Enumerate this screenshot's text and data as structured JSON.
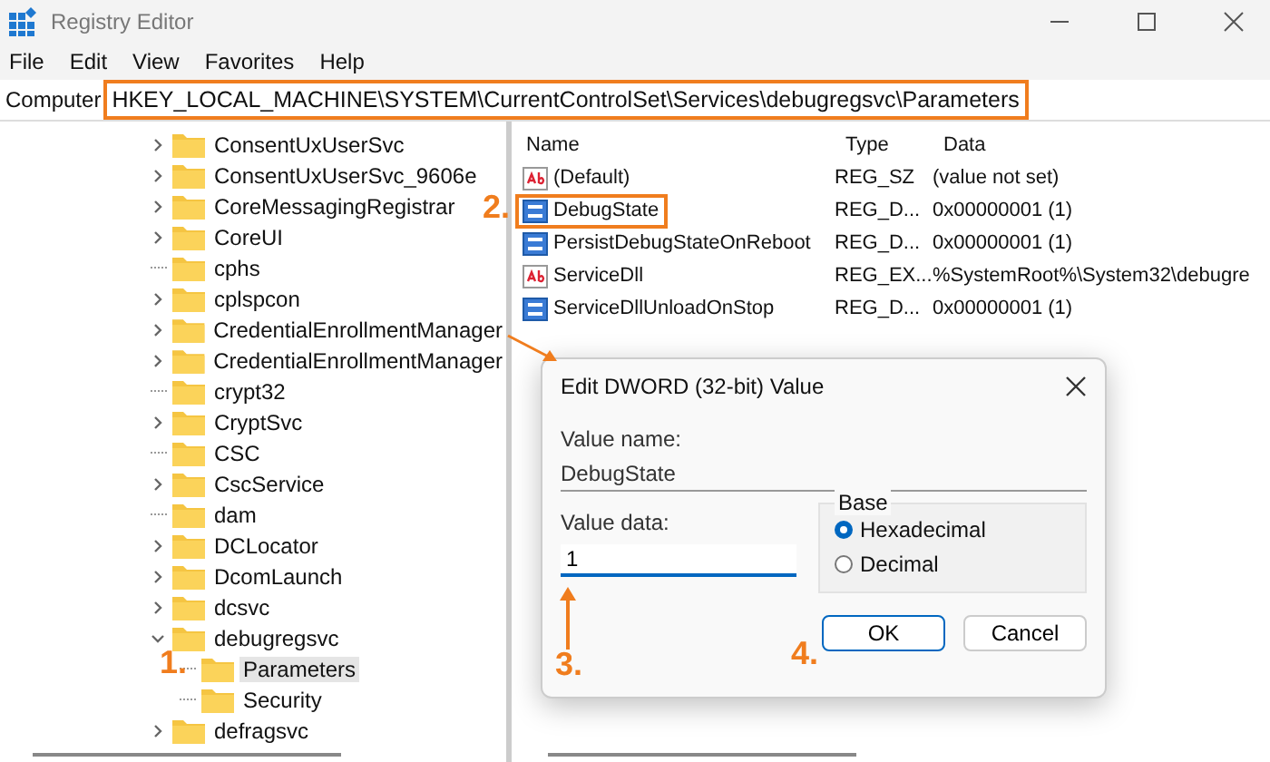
{
  "window": {
    "title": "Registry Editor"
  },
  "menu": [
    "File",
    "Edit",
    "View",
    "Favorites",
    "Help"
  ],
  "address": {
    "prefix": "Computer",
    "path": "HKEY_LOCAL_MACHINE\\SYSTEM\\CurrentControlSet\\Services\\debugregsvc\\Parameters",
    "highlighted": true
  },
  "tree": [
    {
      "label": "ConsentUxUserSvc",
      "expandable": true,
      "expanded": false,
      "selected": false
    },
    {
      "label": "ConsentUxUserSvc_9606e",
      "expandable": true,
      "expanded": false,
      "selected": false
    },
    {
      "label": "CoreMessagingRegistrar",
      "expandable": true,
      "expanded": false,
      "selected": false
    },
    {
      "label": "CoreUI",
      "expandable": true,
      "expanded": false,
      "selected": false
    },
    {
      "label": "cphs",
      "expandable": false,
      "selected": false
    },
    {
      "label": "cplspcon",
      "expandable": true,
      "expanded": false,
      "selected": false
    },
    {
      "label": "CredentialEnrollmentManager",
      "expandable": true,
      "expanded": false,
      "selected": false
    },
    {
      "label": "CredentialEnrollmentManager",
      "expandable": true,
      "expanded": false,
      "selected": false
    },
    {
      "label": "crypt32",
      "expandable": false,
      "selected": false
    },
    {
      "label": "CryptSvc",
      "expandable": true,
      "expanded": false,
      "selected": false
    },
    {
      "label": "CSC",
      "expandable": false,
      "selected": false
    },
    {
      "label": "CscService",
      "expandable": true,
      "expanded": false,
      "selected": false
    },
    {
      "label": "dam",
      "expandable": false,
      "selected": false
    },
    {
      "label": "DCLocator",
      "expandable": true,
      "expanded": false,
      "selected": false
    },
    {
      "label": "DcomLaunch",
      "expandable": true,
      "expanded": false,
      "selected": false
    },
    {
      "label": "dcsvc",
      "expandable": true,
      "expanded": false,
      "selected": false
    },
    {
      "label": "debugregsvc",
      "expandable": true,
      "expanded": true,
      "selected": false,
      "children": [
        {
          "label": "Parameters",
          "selected": true
        },
        {
          "label": "Security",
          "selected": false
        }
      ]
    },
    {
      "label": "defragsvc",
      "expandable": true,
      "expanded": false,
      "selected": false
    }
  ],
  "values": {
    "columns": [
      "Name",
      "Type",
      "Data"
    ],
    "rows": [
      {
        "kind": "string",
        "name": "(Default)",
        "type": "REG_SZ",
        "data": "(value not set)",
        "highlighted": false
      },
      {
        "kind": "binary",
        "name": "DebugState",
        "type": "REG_D...",
        "data": "0x00000001 (1)",
        "highlighted": true
      },
      {
        "kind": "binary",
        "name": "PersistDebugStateOnReboot",
        "type": "REG_D...",
        "data": "0x00000001 (1)",
        "highlighted": false
      },
      {
        "kind": "string",
        "name": "ServiceDll",
        "type": "REG_EX...",
        "data": "%SystemRoot%\\System32\\debugre",
        "highlighted": false
      },
      {
        "kind": "binary",
        "name": "ServiceDllUnloadOnStop",
        "type": "REG_D...",
        "data": "0x00000001 (1)",
        "highlighted": false
      }
    ]
  },
  "dialog": {
    "title": "Edit DWORD (32-bit) Value",
    "value_name_label": "Value name:",
    "value_name": "DebugState",
    "value_data_label": "Value data:",
    "value_data": "1",
    "base_label": "Base",
    "bases": [
      {
        "label": "Hexadecimal",
        "selected": true
      },
      {
        "label": "Decimal",
        "selected": false
      }
    ],
    "buttons": [
      {
        "label": "OK",
        "default": true
      },
      {
        "label": "Cancel",
        "default": false
      }
    ]
  },
  "annotations": [
    "1.",
    "2.",
    "3.",
    "4."
  ]
}
